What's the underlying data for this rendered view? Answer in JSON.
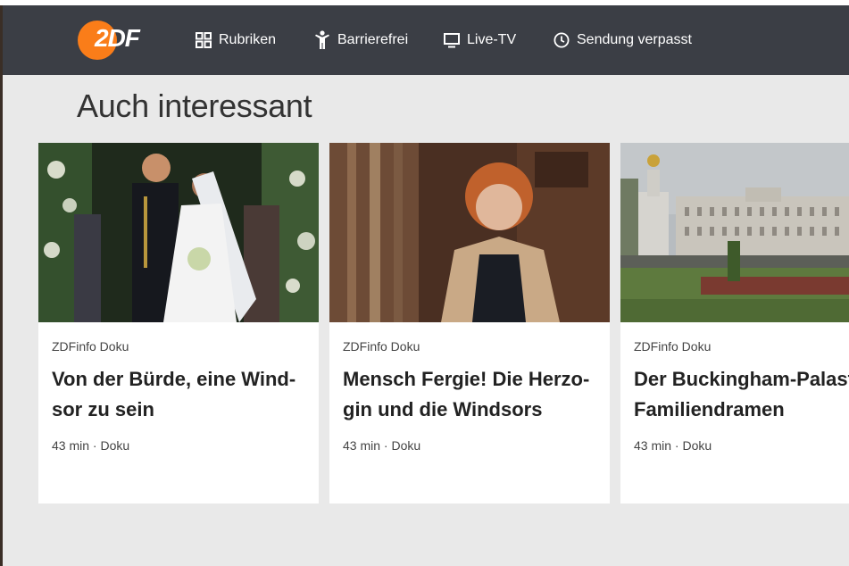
{
  "brand": {
    "logo_text": "2DF",
    "accent": "#fa7d19"
  },
  "nav": {
    "items": [
      {
        "label": "Rubriken",
        "icon": "grid-icon"
      },
      {
        "label": "Barrierefrei",
        "icon": "accessibility-icon"
      },
      {
        "label": "Live-TV",
        "icon": "tv-icon"
      },
      {
        "label": "Sendung verpasst",
        "icon": "clock-icon"
      }
    ]
  },
  "section": {
    "title": "Auch interessant"
  },
  "cards": [
    {
      "kicker": "ZDFinfo Doku",
      "title_line1": "Von der Bürde, eine Wind-",
      "title_line2": "sor zu sein",
      "meta": "43 min · Doku",
      "image": "royal-wedding-photo"
    },
    {
      "kicker": "ZDFinfo Doku",
      "title_line1": "Mensch Fergie! Die Herzo-",
      "title_line2": "gin und die Windsors",
      "meta": "43 min · Doku",
      "image": "portrait-photo"
    },
    {
      "kicker": "ZDFinfo Doku",
      "title_line1": "Der Buckingham-Palast",
      "title_line2": "Familiendramen",
      "meta": "43 min · Doku",
      "image": "buckingham-palace-photo"
    }
  ]
}
